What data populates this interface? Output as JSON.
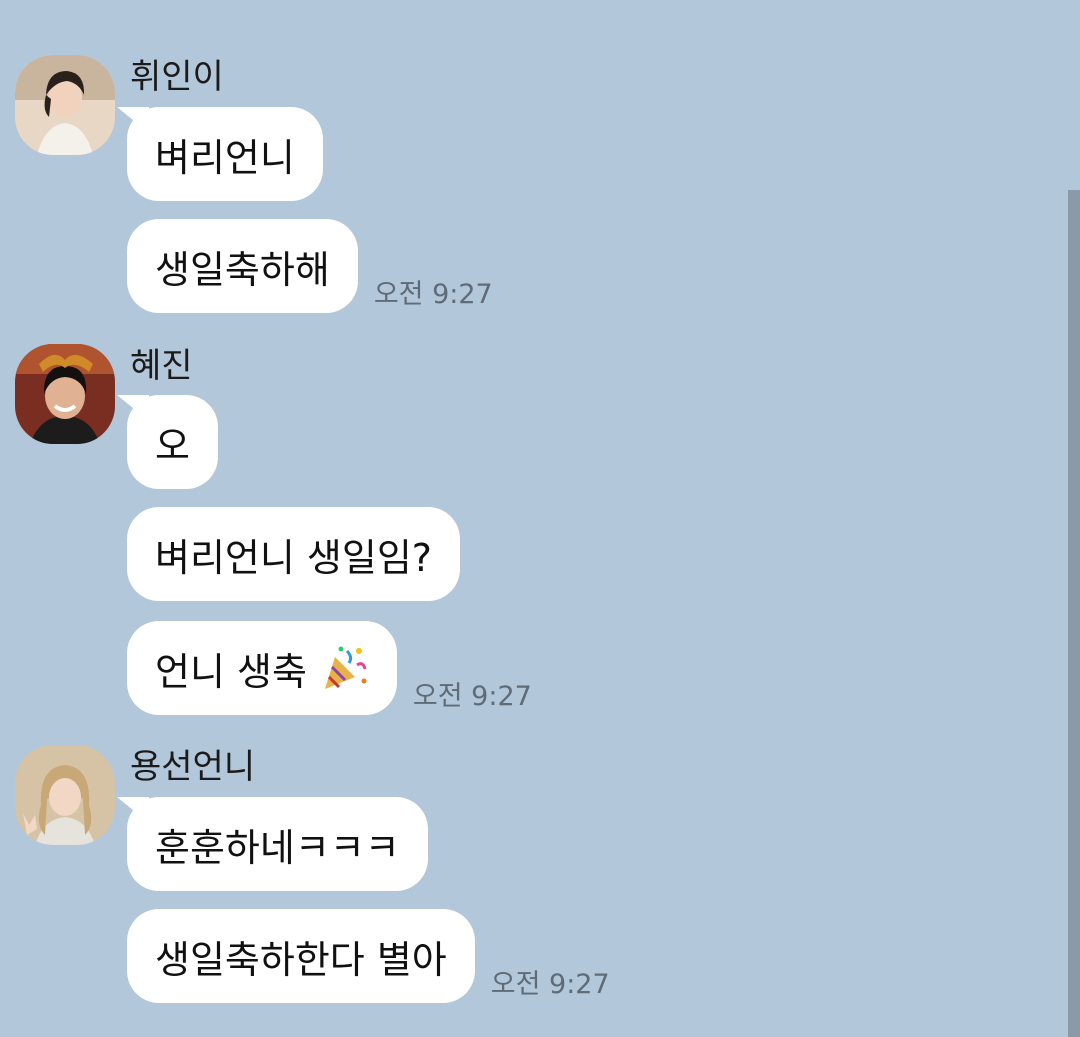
{
  "chat": {
    "groups": [
      {
        "sender": "휘인이",
        "messages": [
          "벼리언니",
          "생일축하해"
        ],
        "time": "오전 9:27"
      },
      {
        "sender": "혜진",
        "messages": [
          "오",
          "벼리언니 생일임?",
          "언니 생축"
        ],
        "emoji": "party-popper-icon",
        "time": "오전 9:27"
      },
      {
        "sender": "용선언니",
        "messages": [
          "훈훈하네ㅋㅋㅋ",
          "생일축하한다 별아"
        ],
        "time": "오전 9:27"
      }
    ]
  },
  "colors": {
    "background": "#b2c7da",
    "bubble": "#ffffff",
    "scrollbar": "#8b9aa8"
  }
}
